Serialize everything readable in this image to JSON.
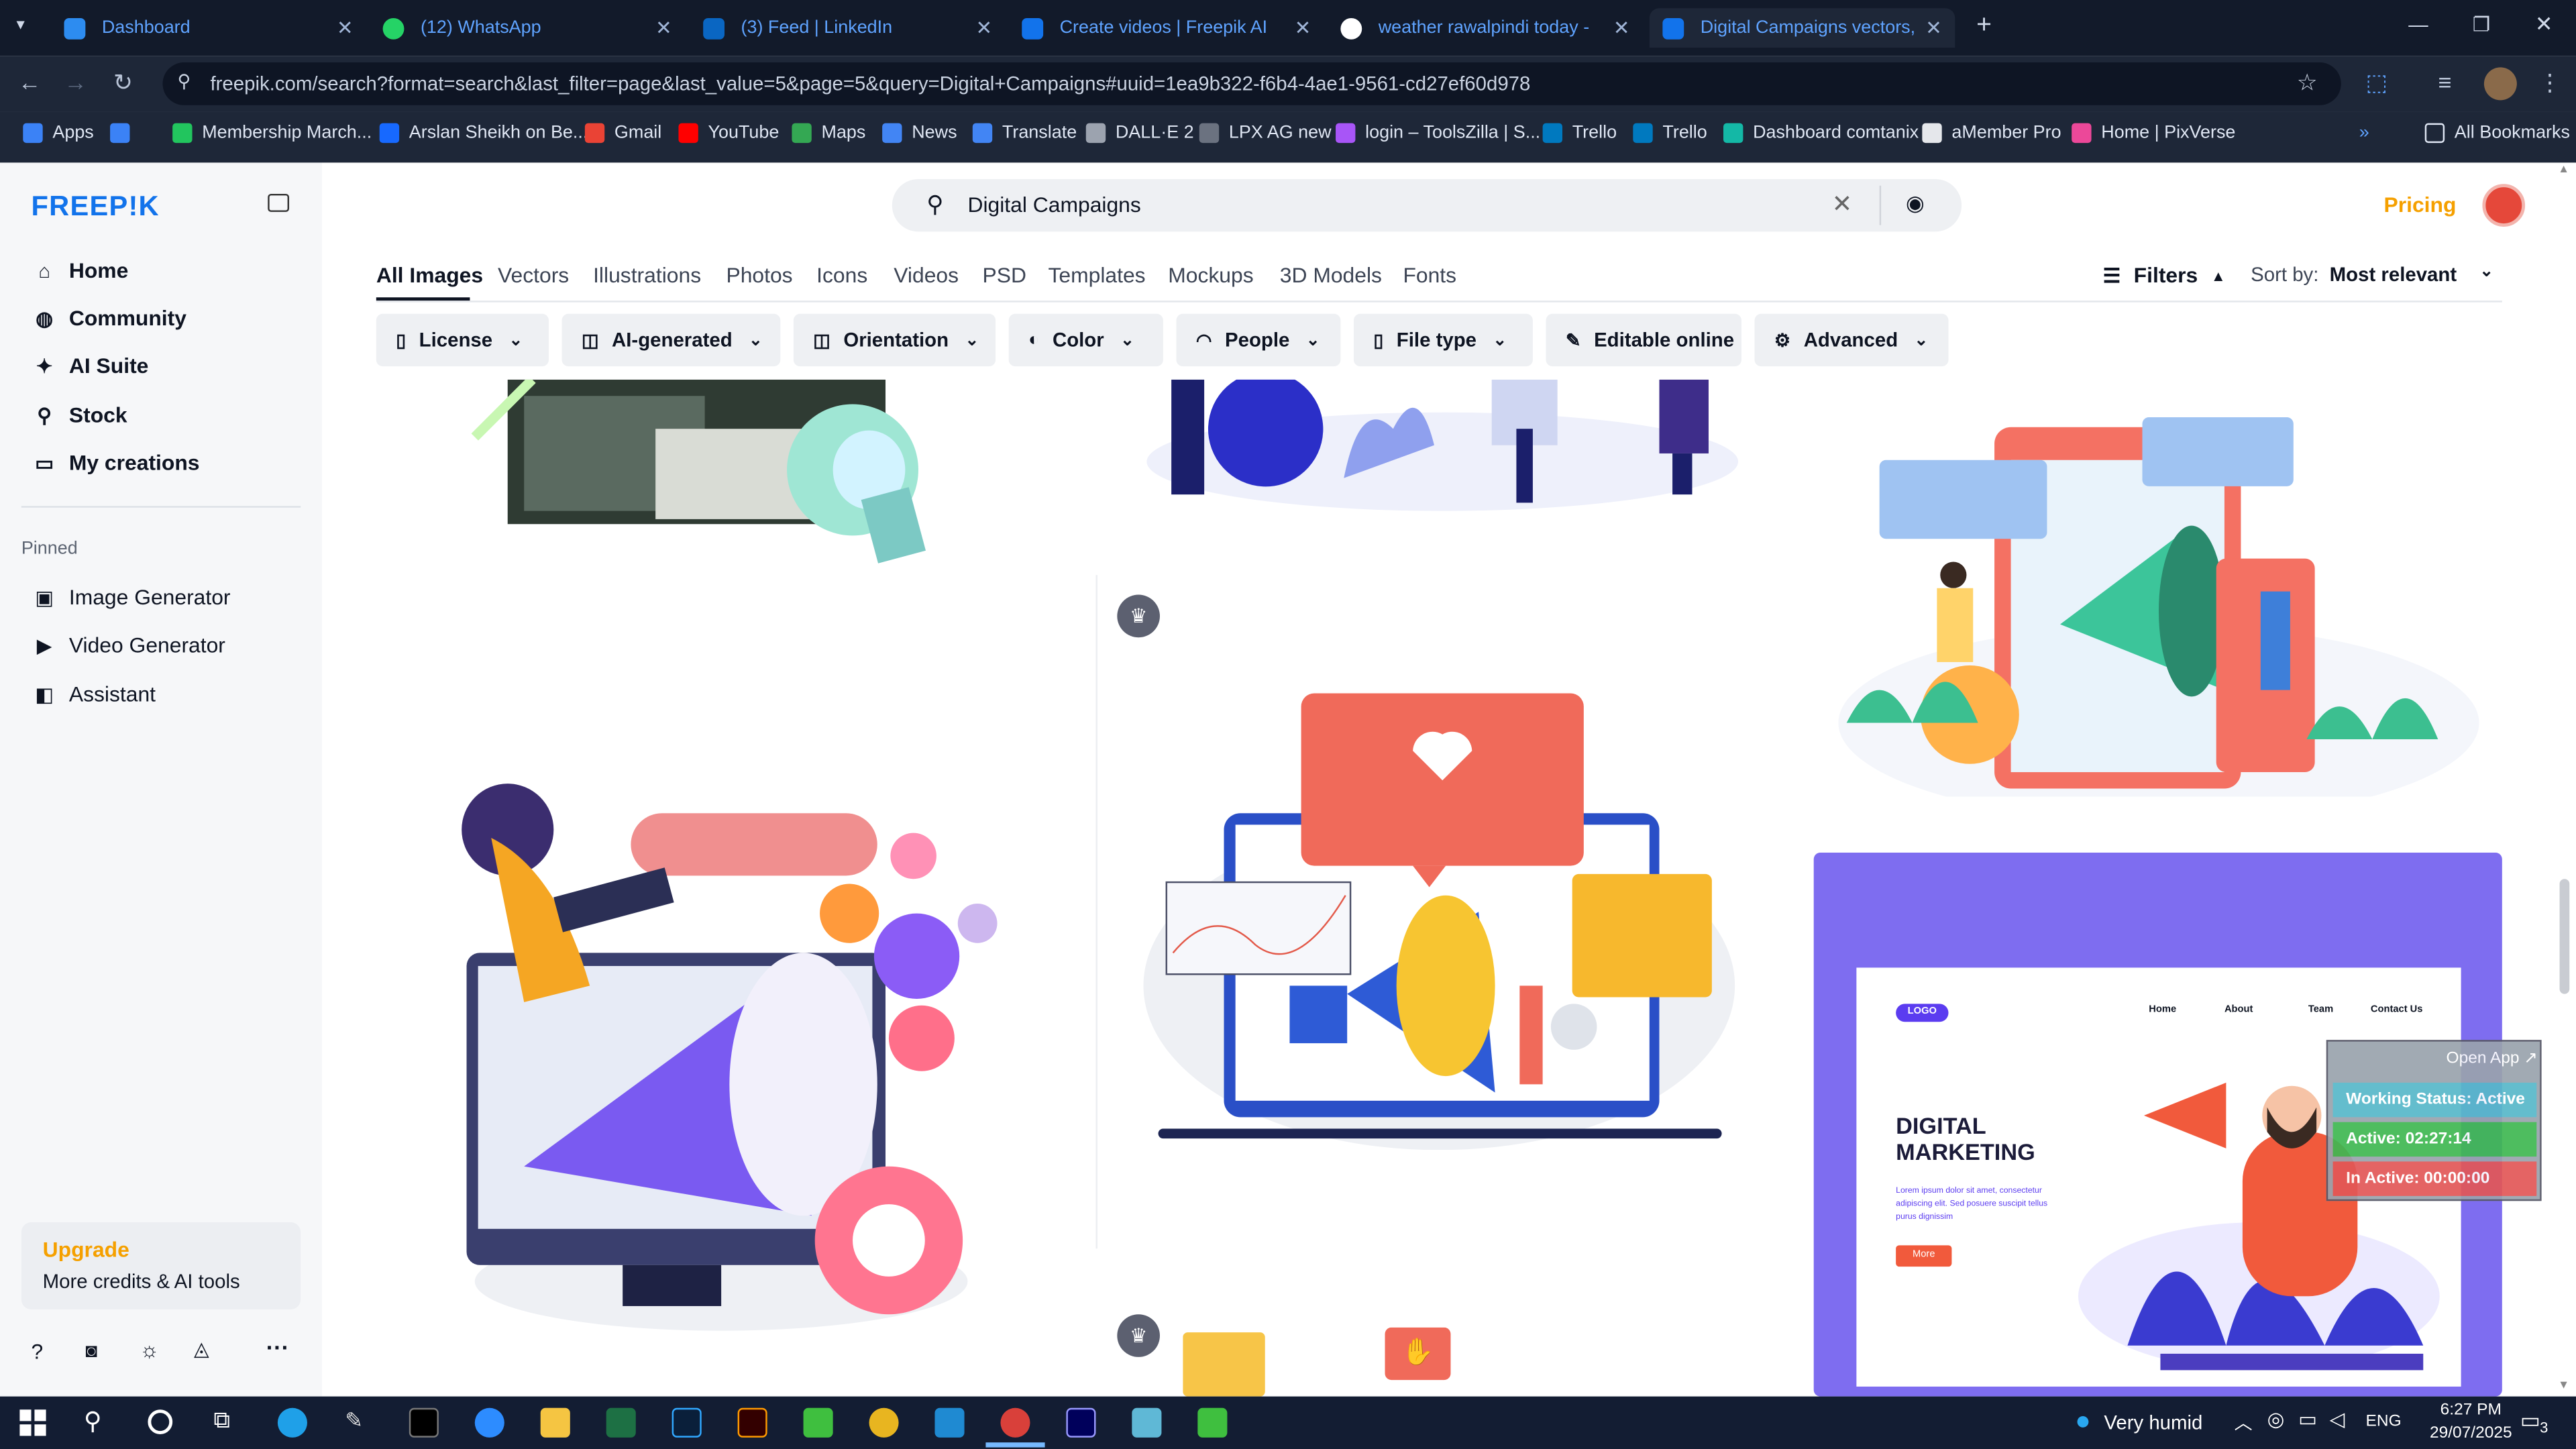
{
  "browser": {
    "tabs": [
      {
        "label": "Dashboard",
        "color": "#2d8cf0"
      },
      {
        "label": "(12) WhatsApp",
        "color": "#25d366"
      },
      {
        "label": "(3) Feed | LinkedIn",
        "color": "#0a66c2"
      },
      {
        "label": "Create videos | Freepik AI",
        "color": "#1273eb"
      },
      {
        "label": "weather rawalpindi today - Goo",
        "color": "#ffffff"
      },
      {
        "label": "Digital Campaigns vectors, pho",
        "color": "#1273eb"
      }
    ],
    "url": "freepik.com/search?format=search&last_filter=page&last_value=5&page=5&query=Digital+Campaigns#uuid=1ea9b322-f6b4-4ae1-9561-cd27ef60d978",
    "bookmarks": [
      "Apps",
      "Membership March...",
      "Arslan Sheikh on Be...",
      "Gmail",
      "YouTube",
      "Maps",
      "News",
      "Translate",
      "DALL·E 2",
      "LPX AG new",
      "login – ToolsZilla | S...",
      "Trello",
      "Trello",
      "Dashboard comtanix",
      "aMember Pro",
      "Home | PixVerse"
    ],
    "all_bookmarks": "All Bookmarks"
  },
  "sidebar": {
    "logo": "FREEP!K",
    "nav": [
      "Home",
      "Community",
      "AI Suite",
      "Stock",
      "My creations"
    ],
    "pinned_label": "Pinned",
    "pinned": [
      "Image Generator",
      "Video Generator",
      "Assistant"
    ],
    "upgrade_title": "Upgrade",
    "upgrade_sub": "More credits & AI tools"
  },
  "header": {
    "search_value": "Digital Campaigns",
    "pricing": "Pricing"
  },
  "categories": [
    "All Images",
    "Vectors",
    "Illustrations",
    "Photos",
    "Icons",
    "Videos",
    "PSD",
    "Templates",
    "Mockups",
    "3D Models",
    "Fonts"
  ],
  "filters_label": "Filters",
  "sort_label": "Sort by:",
  "sort_value": "Most relevant",
  "chips": [
    "License",
    "AI-generated",
    "Orientation",
    "Color",
    "People",
    "File type",
    "Editable online",
    "Advanced"
  ],
  "card": {
    "logo": "LOGO",
    "nav": [
      "Home",
      "About",
      "Team",
      "Contact Us"
    ],
    "title": "DIGITAL MARKETING",
    "body": "Lorem ipsum dolor sit amet, consectetur adipiscing elit. Sed posuere suscipit tellus purus dignissim",
    "button": "More"
  },
  "overlay": {
    "open_app": "Open App ↗",
    "working": "Working Status: Active",
    "active": "Active: 02:27:14",
    "inactive": "In Active: 00:00:00"
  },
  "taskbar": {
    "weather": "Very humid",
    "lang": "ENG",
    "time": "6:27 PM",
    "date": "29/07/2025",
    "notif_count": "3"
  }
}
